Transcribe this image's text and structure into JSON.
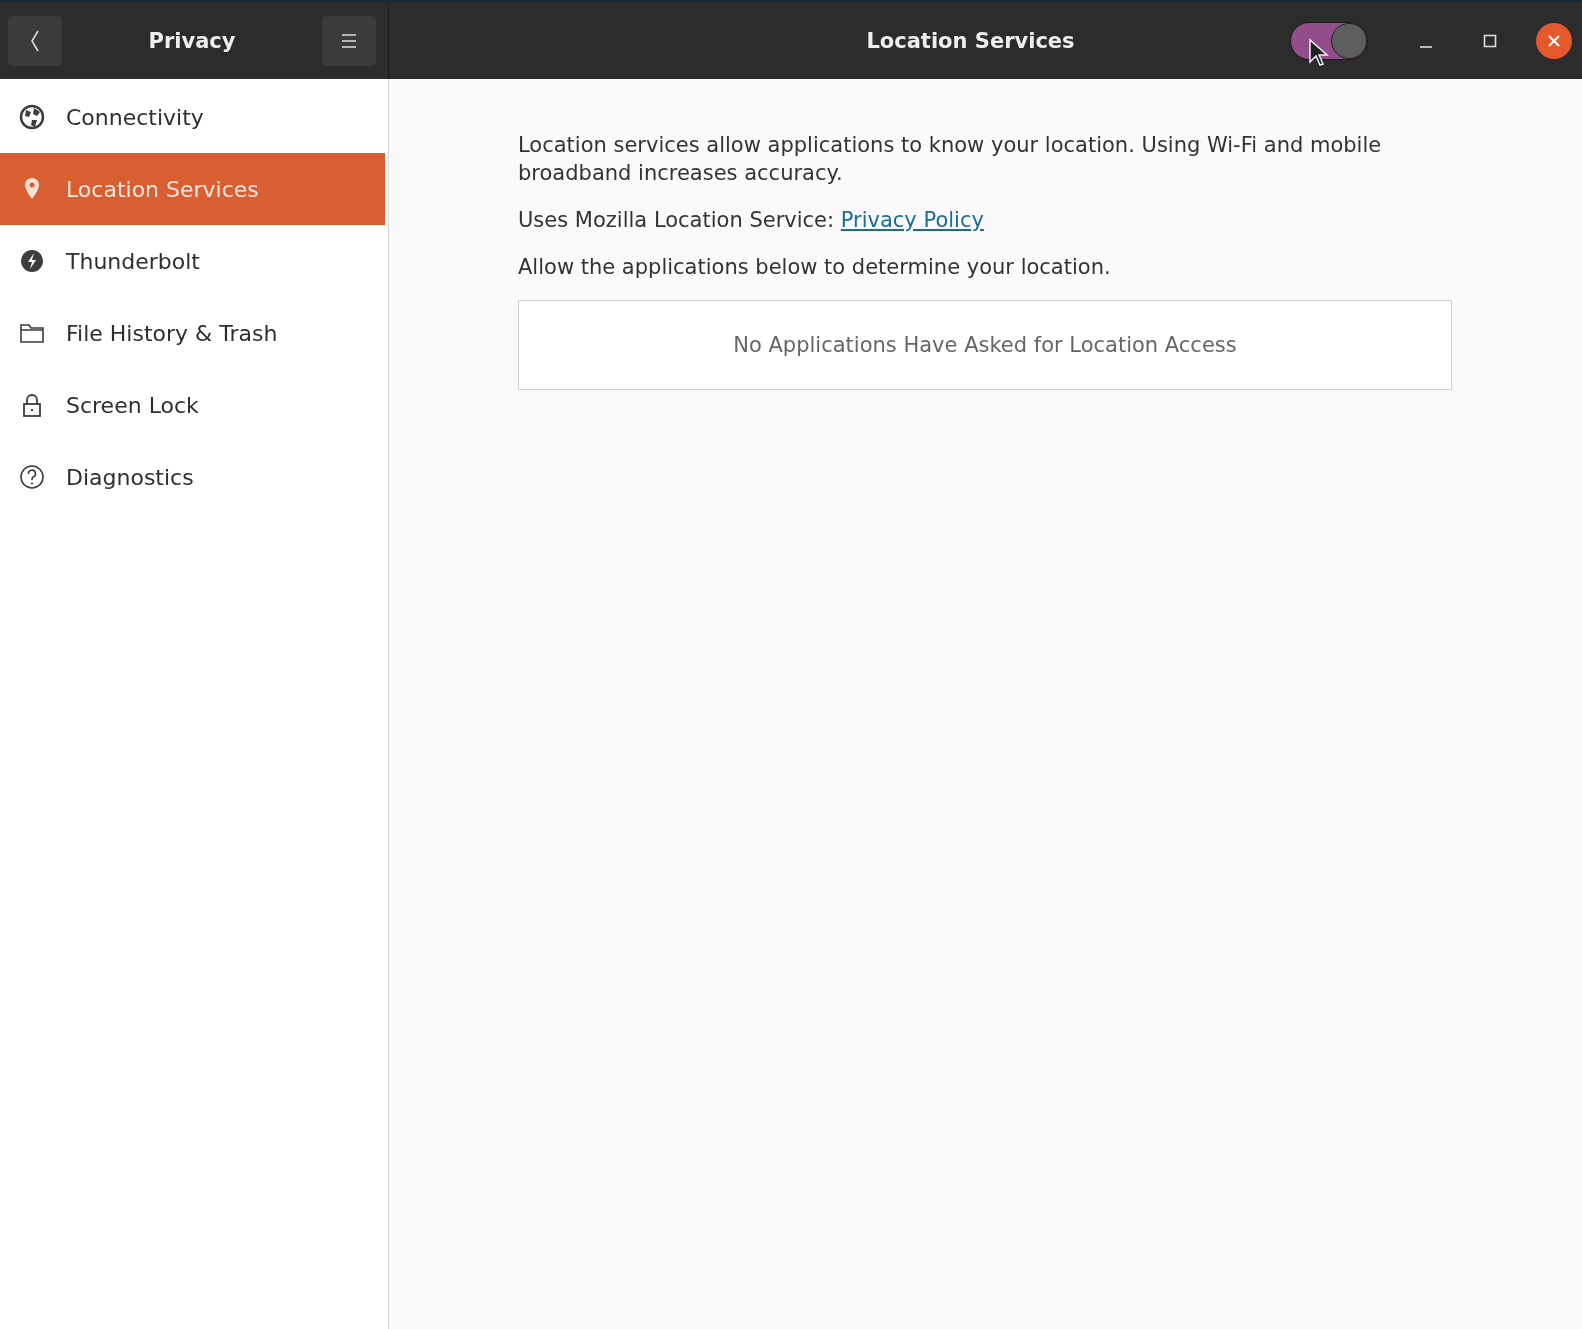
{
  "header": {
    "sidebar_title": "Privacy",
    "title": "Location Services",
    "toggle": {
      "on": true
    }
  },
  "sidebar": {
    "items": [
      {
        "label": "Connectivity",
        "selected": false
      },
      {
        "label": "Location Services",
        "selected": true
      },
      {
        "label": "Thunderbolt",
        "selected": false
      },
      {
        "label": "File History & Trash",
        "selected": false
      },
      {
        "label": "Screen Lock",
        "selected": false
      },
      {
        "label": "Diagnostics",
        "selected": false
      }
    ]
  },
  "content": {
    "description": "Location services allow applications to know your location. Using Wi-Fi and mobile broadband increases accuracy.",
    "service_text": "Uses Mozilla Location Service:",
    "service_link": "Privacy Policy",
    "allow_text": "Allow the applications below to determine your location.",
    "empty_message": "No Applications Have Asked for Location Access"
  }
}
